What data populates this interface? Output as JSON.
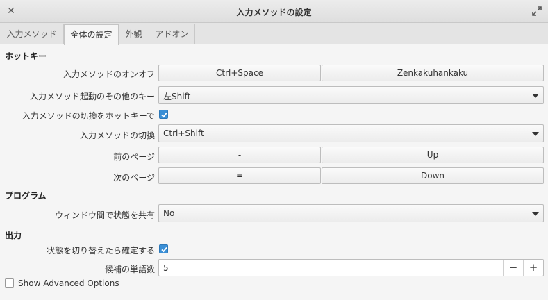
{
  "window": {
    "title": "入力メソッドの設定"
  },
  "tabs": [
    {
      "label": "入力メソッド"
    },
    {
      "label": "全体の設定"
    },
    {
      "label": "外観"
    },
    {
      "label": "アドオン"
    }
  ],
  "active_tab": "全体の設定",
  "hotkey": {
    "section_label": "ホットキー",
    "toggle_label": "入力メソッドのオンオフ",
    "toggle_key1": "Ctrl+Space",
    "toggle_key2": "Zenkakuhankaku",
    "extra_label": "入力メソッド起動のその他のキー",
    "extra_value": "左Shift",
    "switch_enable_label": "入力メソッドの切換をホットキーで",
    "switch_enable_checked": true,
    "switch_label": "入力メソッドの切換",
    "switch_value": "Ctrl+Shift",
    "prev_page_label": "前のページ",
    "prev_key1": "-",
    "prev_key2": "Up",
    "next_page_label": "次のページ",
    "next_key1": "=",
    "next_key2": "Down"
  },
  "program": {
    "section_label": "プログラム",
    "share_label": "ウィンドウ間で状態を共有",
    "share_value": "No"
  },
  "output": {
    "section_label": "出力",
    "commit_label": "状態を切り替えたら確定する",
    "commit_checked": true,
    "candidates_label": "候補の単語数",
    "candidates_value": "5",
    "minus": "−",
    "plus": "+"
  },
  "advanced": {
    "label": "Show Advanced Options",
    "checked": false
  },
  "colors": {
    "accent": "#3a8fd6"
  }
}
